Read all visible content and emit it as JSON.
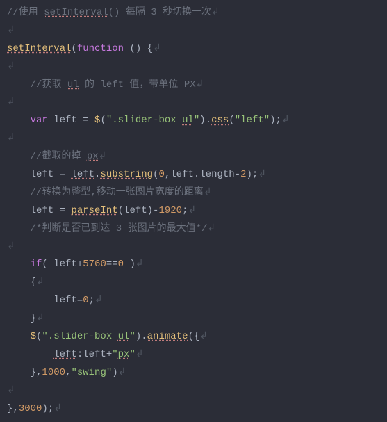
{
  "code": {
    "l1_a": "//使用 ",
    "l1_b": "setInterval",
    "l1_c": "() 每隔 3 秒切换一次",
    "blank": "",
    "l3_a": "setInterval",
    "l3_b": "(",
    "l3_c": "function",
    "l3_d": " () {",
    "l5_a": "    //获取 ",
    "l5_b": "ul",
    "l5_c": " 的 left 值，带单位 PX",
    "l7_a": "    ",
    "l7_b": "var",
    "l7_c": " left = ",
    "l7_d": "$",
    "l7_e": "(",
    "l7_f": "\".slider-box ",
    "l7_g": "ul",
    "l7_h": "\"",
    "l7_i": ").",
    "l7_j": "css",
    "l7_k": "(",
    "l7_l": "\"left\"",
    "l7_m": ");",
    "l9_a": "    //截取的掉 ",
    "l9_b": "px",
    "l10_a": "    left = ",
    "l10_b": "left",
    "l10_c": ".",
    "l10_d": "substring",
    "l10_e": "(",
    "l10_f": "0",
    "l10_g": ",left.length-",
    "l10_h": "2",
    "l10_i": ");",
    "l11": "    //转换为整型,移动一张图片宽度的距离",
    "l12_a": "    left = ",
    "l12_b": "parseInt",
    "l12_c": "(left)-",
    "l12_d": "1920",
    "l12_e": ";",
    "l13": "    /*判断是否已到达 3 张图片的最大值*/",
    "l15_a": "    ",
    "l15_b": "if",
    "l15_c": "( left+",
    "l15_d": "5760",
    "l15_e": "==",
    "l15_f": "0",
    "l15_g": " )",
    "l16": "    {",
    "l17_a": "        left=",
    "l17_b": "0",
    "l17_c": ";",
    "l18": "    }",
    "l19_a": "    ",
    "l19_b": "$",
    "l19_c": "(",
    "l19_d": "\".slider-box ",
    "l19_e": "ul",
    "l19_f": "\"",
    "l19_g": ").",
    "l19_h": "animate",
    "l19_i": "({",
    "l20_a": "        ",
    "l20_b": "left",
    "l20_c": ":left+",
    "l20_d": "\"",
    "l20_e": "px",
    "l20_f": "\"",
    "l21_a": "    },",
    "l21_b": "1000",
    "l21_c": ",",
    "l21_d": "\"swing\"",
    "l21_e": ")",
    "l23_a": "},",
    "l23_b": "3000",
    "l23_c": ");",
    "p": "↲"
  }
}
